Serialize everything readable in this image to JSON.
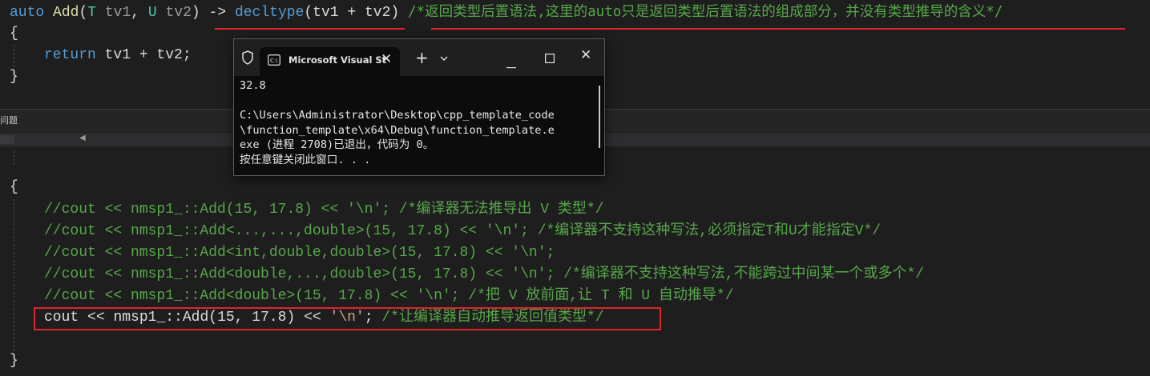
{
  "editor_top": {
    "line1": {
      "auto": "auto",
      "fn": "Add",
      "open": "(",
      "T": "T",
      "tv1": "tv1",
      "comma": ", ",
      "U": "U",
      "tv2": "tv2",
      "close": ")",
      "arrow": " -> ",
      "decltype": "decltype",
      "expr": "(tv1 + tv2)",
      "comment": "/*返回类型后置语法,这里的auto只是返回类型后置语法的组成部分，并没有类型推导的含义*/"
    },
    "line2": "{",
    "line3_kw": "return",
    "line3_rest": " tv1 + tv2;",
    "line4": "}"
  },
  "splitter": {
    "label": "问题",
    "left_arrow": "◀"
  },
  "editor_bottom": {
    "brace_open": "{",
    "c1": "//cout << nmsp1_::Add(15, 17.8) << '\\n'; /*编译器无法推导出 V 类型*/",
    "c2": "//cout << nmsp1_::Add<...,...,double>(15, 17.8) << '\\n'; /*编译器不支持这种写法,必须指定T和U才能指定V*/",
    "c3": "//cout << nmsp1_::Add<int,double,double>(15, 17.8) << '\\n';",
    "c4": "//cout << nmsp1_::Add<double,...,double>(15, 17.8) << '\\n'; /*编译器不支持这种写法,不能跨过中间某一个或多个*/",
    "c5": "//cout << nmsp1_::Add<double>(15, 17.8) << '\\n'; /*把 V 放前面,让 T 和 U 自动推导*/",
    "active": {
      "cout": "cout",
      "op1": " << ",
      "ns": "nmsp1_",
      "scope": "::",
      "fn": "Add",
      "args": "(15, 17.8)",
      "op2": " << ",
      "str": "'\\n'",
      "semi": "; ",
      "comment": "/*让编译器自动推导返回值类型*/"
    },
    "brace_close": "}"
  },
  "console_window": {
    "tab_title": "Microsoft Visual St",
    "output": "32.8\n\nC:\\Users\\Administrator\\Desktop\\cpp_template_code\n\\function_template\\x64\\Debug\\function_template.e\nexe (进程 2708)已退出，代码为 0。\n按任意键关闭此窗口. . ."
  },
  "colors": {
    "comment": "#57a64a",
    "keyword": "#569cd6",
    "highlight": "#e0242b",
    "editor_bg": "#1e1e1e"
  }
}
